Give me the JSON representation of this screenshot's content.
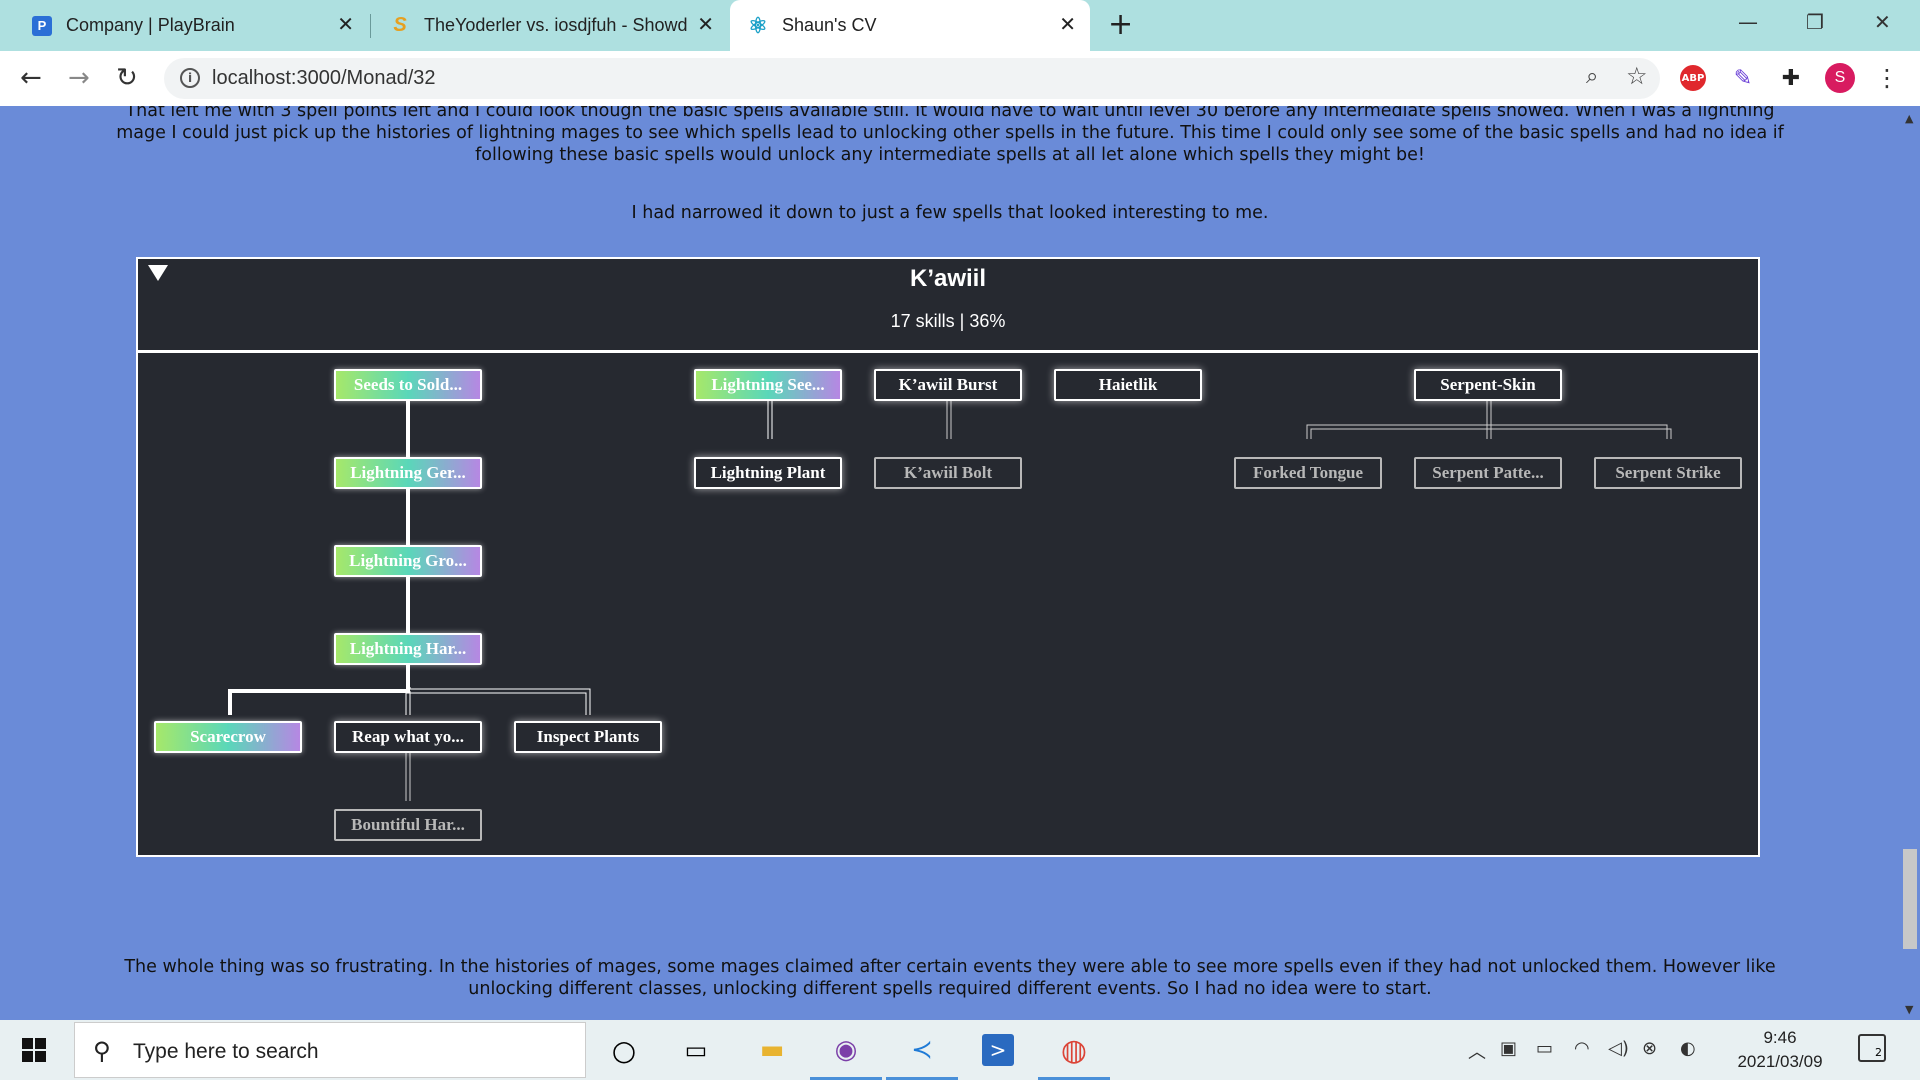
{
  "browser": {
    "tabs": [
      {
        "title": "Company | PlayBrain",
        "favicon": "P",
        "favicon_color": "#2b6fd6",
        "active": false
      },
      {
        "title": "TheYoderler vs. iosdjfuh - Showd",
        "favicon": "S",
        "favicon_color": "#f0a020",
        "active": false
      },
      {
        "title": "Shaun's CV",
        "favicon": "⚛",
        "favicon_color": "#1da1c8",
        "active": true
      }
    ],
    "url": "localhost:3000/Monad/32",
    "profile_initial": "S",
    "abp_label": "ABP"
  },
  "page": {
    "paragraph_top": "That left me with 3 spell points left and I could look though the basic spells available still. It would have to wait until level 30 before any intermediate spells showed. When I was a lightning mage I could just pick up the histories of lightning mages to see which spells lead to unlocking other spells in the future. This time I could only see some of the basic spells and had no idea if following these basic spells would unlock any intermediate spells at all let alone which spells they might be!",
    "paragraph_mid": "I had narrowed it down to just a few spells that looked interesting to me.",
    "paragraph_bottom": "The whole thing was so frustrating. In the histories of mages, some mages claimed after certain events they were able to see more spells even if they had not unlocked them. However like unlocking different classes, unlocking different spells required different events. So I had no idea were to start.",
    "tree": {
      "name": "K’awiil",
      "stats": "17 skills | 36%",
      "nodes": [
        {
          "id": "seeds",
          "label": "Seeds to Sold...",
          "state": "unlocked"
        },
        {
          "id": "lgerm",
          "label": "Lightning Ger...",
          "state": "unlocked"
        },
        {
          "id": "lgro",
          "label": "Lightning Gro...",
          "state": "unlocked"
        },
        {
          "id": "lhar",
          "label": "Lightning Har...",
          "state": "unlocked"
        },
        {
          "id": "scarecrow",
          "label": "Scarecrow",
          "state": "unlocked"
        },
        {
          "id": "reap",
          "label": "Reap what yo...",
          "state": "available"
        },
        {
          "id": "inspect",
          "label": "Inspect Plants",
          "state": "available"
        },
        {
          "id": "bountiful",
          "label": "Bountiful Har...",
          "state": "locked"
        },
        {
          "id": "lseed",
          "label": "Lightning See...",
          "state": "unlocked"
        },
        {
          "id": "lplant",
          "label": "Lightning Plant",
          "state": "available"
        },
        {
          "id": "kburst",
          "label": "K’awiil Burst",
          "state": "available"
        },
        {
          "id": "kbolt",
          "label": "K’awiil Bolt",
          "state": "locked"
        },
        {
          "id": "haietlik",
          "label": "Haietlik",
          "state": "available"
        },
        {
          "id": "serpentskin",
          "label": "Serpent-Skin",
          "state": "available"
        },
        {
          "id": "forked",
          "label": "Forked Tongue",
          "state": "locked"
        },
        {
          "id": "spattern",
          "label": "Serpent Patte...",
          "state": "locked"
        },
        {
          "id": "sstrike",
          "label": "Serpent Strike",
          "state": "locked"
        }
      ]
    }
  },
  "taskbar": {
    "search_placeholder": "Type here to search",
    "time": "9:46",
    "date": "2021/03/09",
    "notification_count": "2"
  }
}
